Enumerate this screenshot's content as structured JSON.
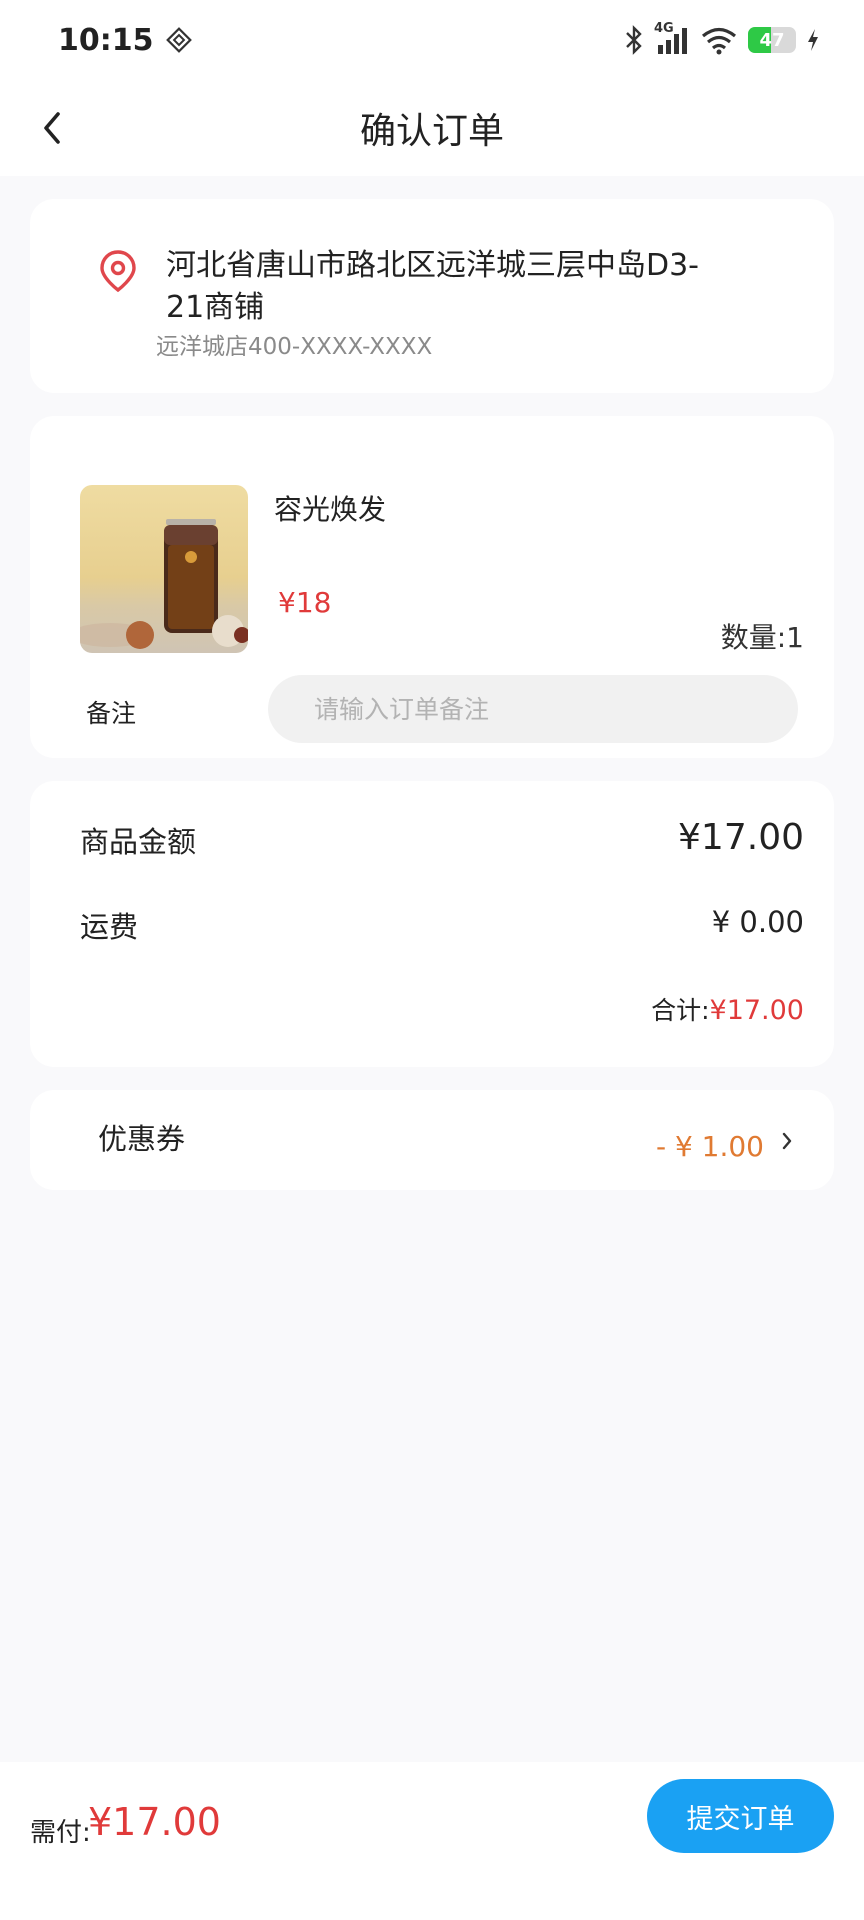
{
  "status_bar": {
    "time": "10:15",
    "network": "4G",
    "battery_level": "47"
  },
  "header": {
    "title": "确认订单"
  },
  "address": {
    "line": "河北省唐山市路北区远洋城三层中岛D3-21商铺",
    "contact": "远洋城店400-XXXX-XXXX"
  },
  "product": {
    "name": "容光焕发",
    "price": "¥18",
    "quantity": "数量:1",
    "remark_label": "备注",
    "remark_placeholder": "请输入订单备注"
  },
  "summary": {
    "goods_label": "商品金额",
    "goods_value": "¥17.00",
    "shipping_label": "运费",
    "shipping_value": "¥ 0.00",
    "total_prefix": "合计:",
    "total_value": "¥17.00"
  },
  "coupon": {
    "label": "优惠券",
    "value": "- ¥ 1.00"
  },
  "footer": {
    "pay_label": "需付:",
    "pay_value": "¥17.00",
    "submit_label": "提交订单"
  },
  "colors": {
    "accent_blue": "#1aa1f3",
    "price_red": "#e03a3a",
    "coupon_orange": "#e07a32",
    "battery_green": "#2ec946"
  }
}
